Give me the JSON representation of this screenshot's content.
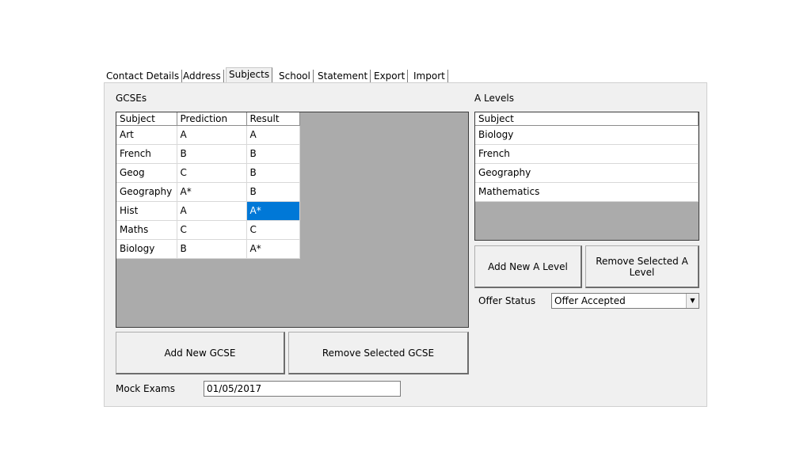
{
  "tabs": [
    {
      "label": "Contact Details",
      "active": false
    },
    {
      "label": "Address",
      "active": false
    },
    {
      "label": "Subjects",
      "active": true
    },
    {
      "label": "School",
      "active": false
    },
    {
      "label": "Statement",
      "active": false
    },
    {
      "label": "Export",
      "active": false
    },
    {
      "label": "Import",
      "active": false
    }
  ],
  "gcse": {
    "section_label": "GCSEs",
    "columns": [
      "Subject",
      "Prediction",
      "Result"
    ],
    "rows": [
      [
        "Art",
        "A",
        "A"
      ],
      [
        "French",
        "B",
        "B"
      ],
      [
        "Geog",
        "C",
        "B"
      ],
      [
        "Geography",
        "A*",
        "B"
      ],
      [
        "Hist",
        "A",
        "A*"
      ],
      [
        "Maths",
        "C",
        "C"
      ],
      [
        "Biology",
        "B",
        "A*"
      ]
    ],
    "add_button": "Add New GCSE",
    "remove_button": "Remove Selected GCSE",
    "mock_label": "Mock Exams",
    "mock_value": "01/05/2017"
  },
  "alevel": {
    "section_label": "A Levels",
    "columns": [
      "Subject"
    ],
    "rows": [
      [
        "Biology"
      ],
      [
        "French"
      ],
      [
        "Geography"
      ],
      [
        "Mathematics"
      ]
    ],
    "add_button": "Add New A Level",
    "remove_button": "Remove Selected A Level",
    "offer_label": "Offer Status",
    "offer_value": "Offer Accepted"
  },
  "colors": {
    "selection": "#0078d7",
    "grid_background": "#ababab",
    "panel": "#f0f0f0"
  },
  "icons": {
    "dropdown": "chevron-down-icon"
  }
}
